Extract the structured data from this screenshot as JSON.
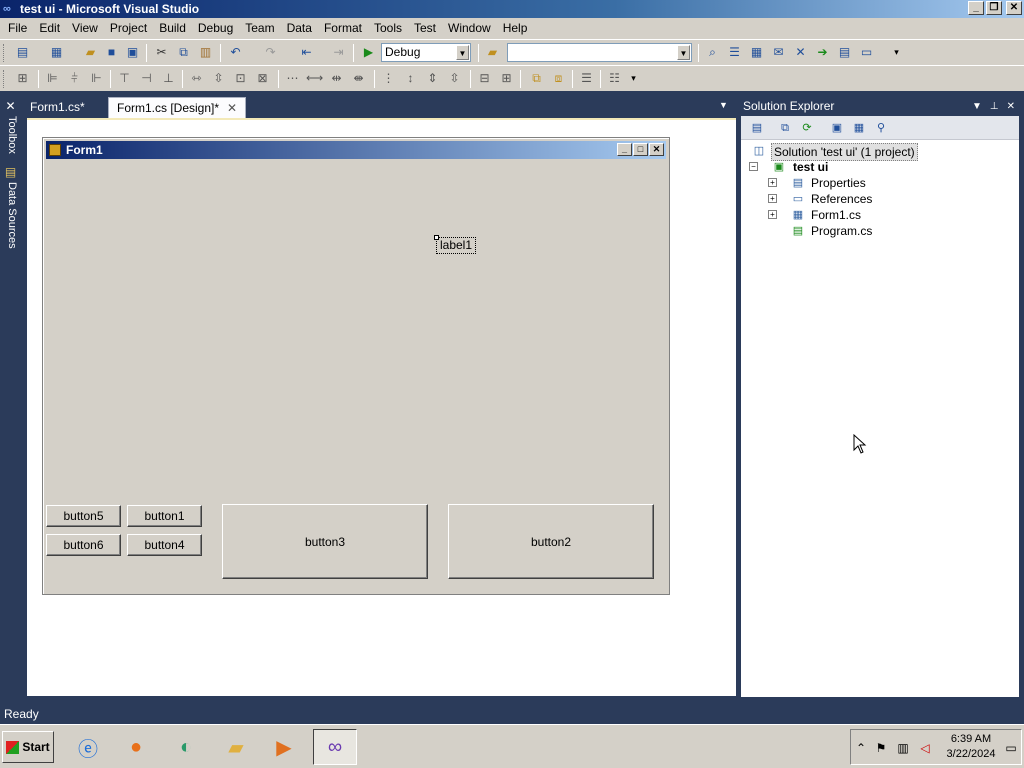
{
  "window": {
    "title": "test ui - Microsoft Visual Studio",
    "controls": [
      "_",
      "❐",
      "✕"
    ]
  },
  "menu": [
    "File",
    "Edit",
    "View",
    "Project",
    "Build",
    "Debug",
    "Team",
    "Data",
    "Format",
    "Tools",
    "Test",
    "Window",
    "Help"
  ],
  "toolbar": {
    "config_value": "Debug",
    "platform_value": ""
  },
  "side_tabs": {
    "toolbox": "Toolbox",
    "data_sources": "Data Sources"
  },
  "doc_tabs": [
    {
      "label": "Form1.cs*",
      "active": false
    },
    {
      "label": "Form1.cs [Design]*",
      "active": true
    }
  ],
  "form": {
    "title": "Form1",
    "label1": "label1",
    "buttons": {
      "button5": "button5",
      "button1": "button1",
      "button6": "button6",
      "button4": "button4",
      "button3": "button3",
      "button2": "button2"
    }
  },
  "solution_explorer": {
    "title": "Solution Explorer",
    "tree": {
      "solution": "Solution 'test ui' (1 project)",
      "project": "test ui",
      "properties": "Properties",
      "references": "References",
      "form1": "Form1.cs",
      "program": "Program.cs"
    }
  },
  "status": {
    "text": "Ready"
  },
  "taskbar": {
    "start": "Start",
    "time": "6:39 AM",
    "date": "3/22/2024"
  }
}
